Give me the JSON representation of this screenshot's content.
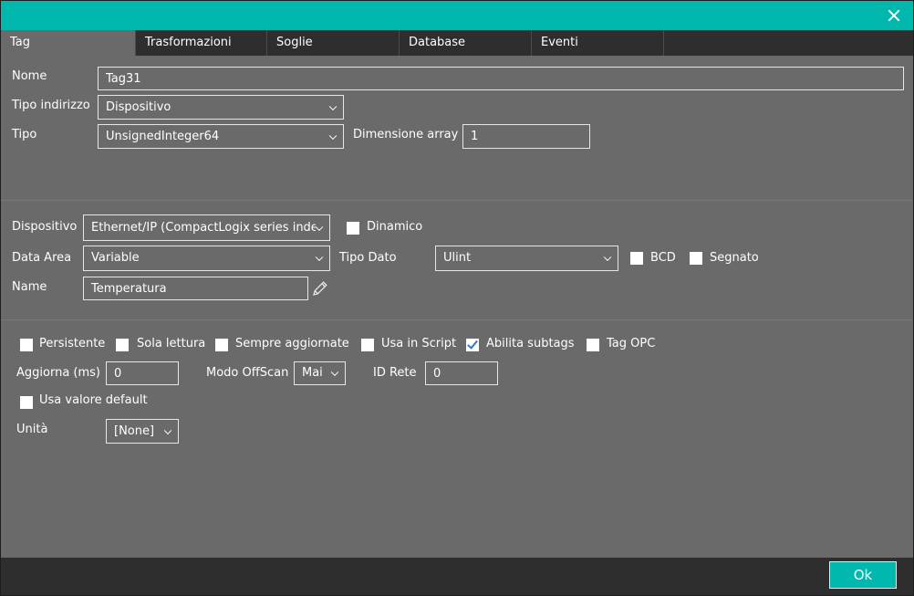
{
  "tabs": [
    "Tag",
    "Trasformazioni",
    "Soglie",
    "Database",
    "Eventi"
  ],
  "general": {
    "nome_label": "Nome",
    "nome_value": "Tag31",
    "tipo_indirizzo_label": "Tipo indirizzo",
    "tipo_indirizzo_value": "Dispositivo",
    "tipo_label": "Tipo",
    "tipo_value": "UnsignedInteger64",
    "dimensione_array_label": "Dimensione array",
    "dimensione_array_value": "1"
  },
  "device": {
    "dispositivo_label": "Dispositivo",
    "dispositivo_value": "Ethernet/IP (CompactLogix series inde",
    "dinamico_label": "Dinamico",
    "data_area_label": "Data Area",
    "data_area_value": "Variable",
    "tipo_dato_label": "Tipo Dato",
    "tipo_dato_value": "Ulint",
    "bcd_label": "BCD",
    "segnato_label": "Segnato",
    "name_label": "Name",
    "name_value": "Temperatura"
  },
  "options": {
    "persistente": "Persistente",
    "sola_lettura": "Sola lettura",
    "sempre_aggiornate": "Sempre aggiornate",
    "usa_in_script": "Usa in Script",
    "abilita_subtags": "Abilita subtags",
    "tag_opc": "Tag OPC",
    "aggiorna_label": "Aggiorna (ms)",
    "aggiorna_value": "0",
    "modo_offscan_label": "Modo OffScan",
    "modo_offscan_value": "Mai",
    "id_rete_label": "ID Rete",
    "id_rete_value": "0",
    "usa_valore_default": "Usa valore default",
    "unita_label": "Unità",
    "unita_value": "[None]"
  },
  "footer": {
    "ok_label": "Ok"
  },
  "icons": {
    "close": "close-icon",
    "pencil": "pencil-icon",
    "chevron": "chevron-down-icon"
  },
  "colors": {
    "accent": "#00b8ad",
    "panel": "#6a6a6a",
    "dark": "#2e2e2e"
  }
}
